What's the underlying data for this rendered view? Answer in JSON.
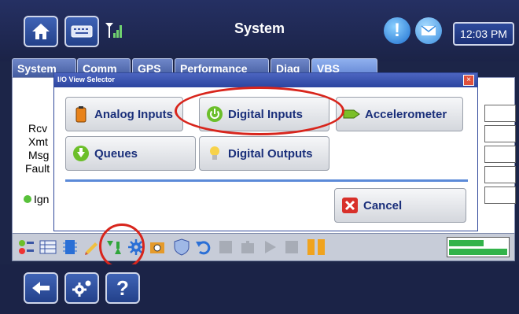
{
  "header": {
    "title": "System",
    "time": "12:03 PM",
    "alert_glyph": "!"
  },
  "tabs": [
    {
      "label": "System"
    },
    {
      "label": "Comm"
    },
    {
      "label": "GPS"
    },
    {
      "label": "Performance"
    },
    {
      "label": "Diag"
    },
    {
      "label": "VBS"
    }
  ],
  "panel": {
    "labels": [
      "Rcv",
      "Xmt",
      "Msg",
      "Fault"
    ],
    "ign_label": "Ign"
  },
  "dialog": {
    "title": "I/O View Selector",
    "close_glyph": "×",
    "buttons": {
      "analog_inputs": "Analog Inputs",
      "digital_inputs": "Digital Inputs",
      "accelerometer": "Accelerometer",
      "queues": "Queues",
      "digital_outputs": "Digital Outputs",
      "cancel": "Cancel"
    }
  },
  "bottom": {
    "help_glyph": "?"
  },
  "colors": {
    "accent": "#2c45a0",
    "highlight_ring": "#d8251c"
  }
}
